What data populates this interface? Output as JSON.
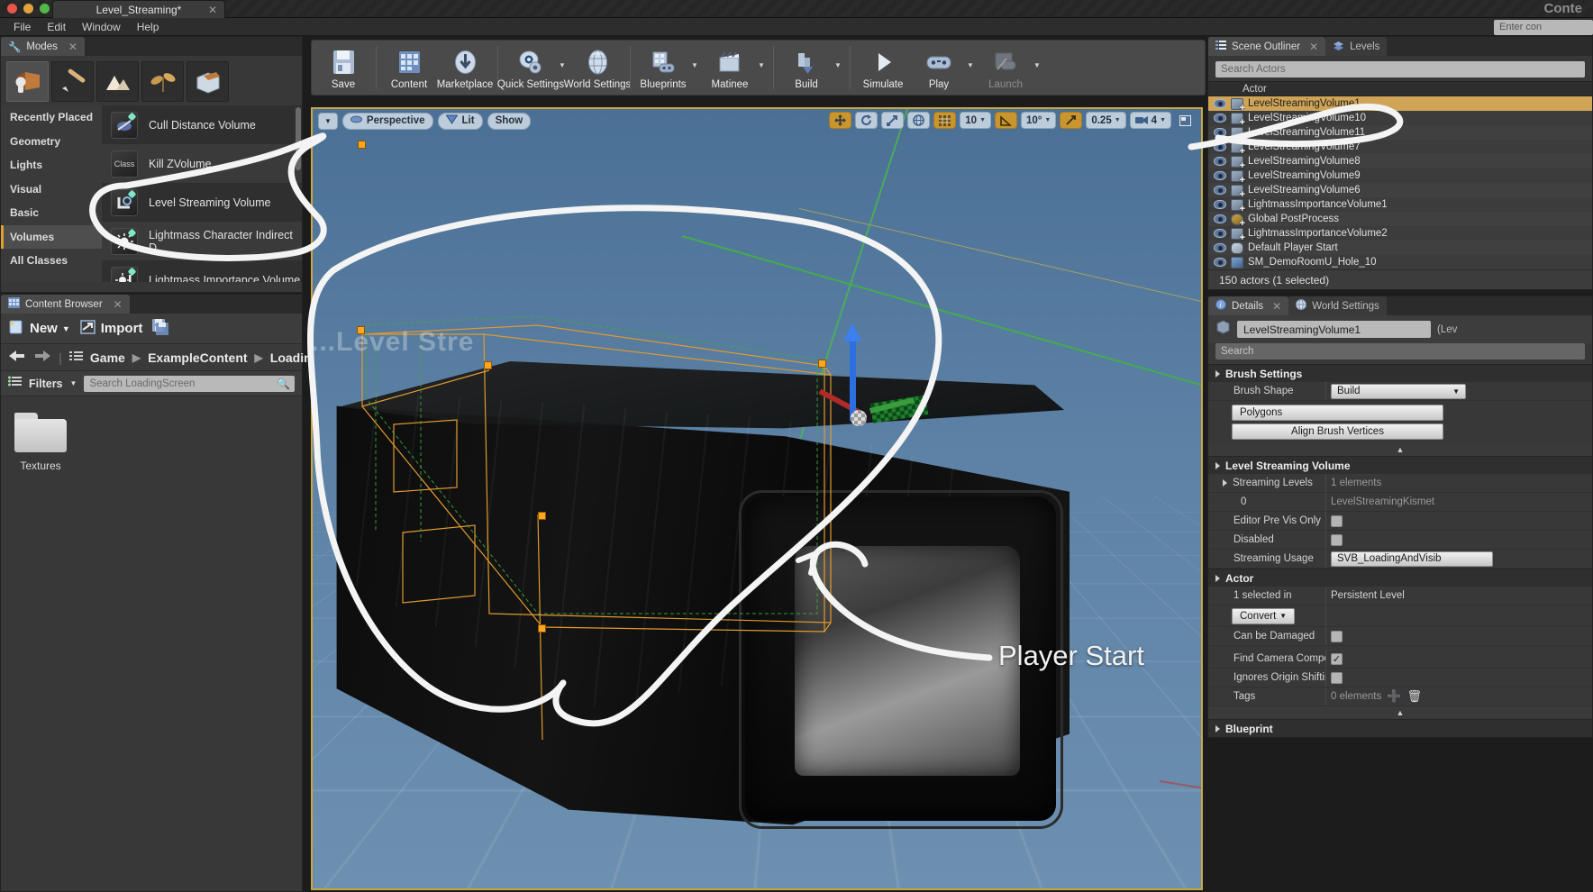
{
  "titlebar": {
    "document_tab": "Level_Streaming*",
    "window_label": "Conte"
  },
  "menubar": {
    "items": [
      "File",
      "Edit",
      "Window",
      "Help"
    ],
    "command_placeholder": "Enter con"
  },
  "modes": {
    "tab_label": "Modes",
    "mode_buttons": [
      "place-mode",
      "paint-mode",
      "landscape-mode",
      "foliage-mode",
      "geometry-edit-mode"
    ],
    "categories": [
      "Recently Placed",
      "Geometry",
      "Lights",
      "Visual",
      "Basic",
      "Volumes",
      "All Classes"
    ],
    "selected_category": "Volumes",
    "volume_items": [
      {
        "label": "Cull Distance Volume",
        "icon": "cull-distance-volume-icon"
      },
      {
        "label": "Kill ZVolume",
        "icon": "class-icon"
      },
      {
        "label": "Level Streaming Volume",
        "icon": "level-streaming-volume-icon"
      },
      {
        "label": "Lightmass Character Indirect D",
        "icon": "lightmass-character-indirect-icon"
      },
      {
        "label": "Lightmass Importance Volume",
        "icon": "lightmass-importance-volume-icon"
      }
    ]
  },
  "toolbar": {
    "buttons": [
      {
        "label": "Save",
        "icon": "save-icon",
        "caret": false,
        "dim": false
      },
      {
        "label": "Content",
        "icon": "content-icon",
        "caret": false,
        "dim": false
      },
      {
        "label": "Marketplace",
        "icon": "marketplace-icon",
        "caret": false,
        "dim": false
      },
      {
        "label": "Quick Settings",
        "icon": "quick-settings-icon",
        "caret": true,
        "dim": false
      },
      {
        "label": "World Settings",
        "icon": "world-settings-icon",
        "caret": false,
        "dim": false
      },
      {
        "label": "Blueprints",
        "icon": "blueprints-icon",
        "caret": true,
        "dim": false
      },
      {
        "label": "Matinee",
        "icon": "matinee-icon",
        "caret": true,
        "dim": false
      },
      {
        "label": "Build",
        "icon": "build-icon",
        "caret": true,
        "dim": false
      },
      {
        "label": "Simulate",
        "icon": "simulate-icon",
        "caret": false,
        "dim": false
      },
      {
        "label": "Play",
        "icon": "play-icon",
        "caret": true,
        "dim": false
      },
      {
        "label": "Launch",
        "icon": "launch-icon",
        "caret": true,
        "dim": true
      }
    ]
  },
  "content_browser": {
    "tab_label": "Content Browser",
    "new_label": "New",
    "import_label": "Import",
    "save_all_icon": "save-all-icon",
    "breadcrumbs": [
      "Game",
      "ExampleContent",
      "Loadin"
    ],
    "filters_label": "Filters",
    "search_placeholder": "Search LoadingScreen",
    "assets": [
      {
        "label": "Textures",
        "icon": "folder-icon"
      }
    ]
  },
  "viewport": {
    "view_mode_label": "Perspective",
    "lighting_label": "Lit",
    "show_label": "Show",
    "grid_snap_value": "10",
    "rotation_snap_value": "10°",
    "scale_snap_value": "0.25",
    "camera_speed_value": "4",
    "watermark_text": "...Level Stre",
    "annotations": [
      {
        "text": "Player Start",
        "kind": "handwriting-label"
      }
    ]
  },
  "scene_outliner": {
    "tabs": [
      {
        "label": "Scene Outliner",
        "icon": "scene-outliner-icon",
        "active": true
      },
      {
        "label": "Levels",
        "icon": "levels-icon",
        "active": false
      }
    ],
    "search_placeholder": "Search Actors",
    "column_header": "Actor",
    "rows": [
      {
        "label": "LevelStreamingVolume1",
        "icon": "volume-actor-icon",
        "selected": true
      },
      {
        "label": "LevelStreamingVolume10",
        "icon": "volume-actor-icon",
        "selected": false
      },
      {
        "label": "LevelStreamingVolume11",
        "icon": "volume-actor-icon",
        "selected": false
      },
      {
        "label": "LevelStreamingVolume7",
        "icon": "volume-actor-icon",
        "selected": false
      },
      {
        "label": "LevelStreamingVolume8",
        "icon": "volume-actor-icon",
        "selected": false
      },
      {
        "label": "LevelStreamingVolume9",
        "icon": "volume-actor-icon",
        "selected": false
      },
      {
        "label": "LevelStreamingVolume6",
        "icon": "volume-actor-icon",
        "selected": false
      },
      {
        "label": "LightmassImportanceVolume1",
        "icon": "volume-actor-icon",
        "selected": false
      },
      {
        "label": "Global PostProcess",
        "icon": "postprocess-actor-icon",
        "selected": false
      },
      {
        "label": "LightmassImportanceVolume2",
        "icon": "volume-actor-icon",
        "selected": false
      },
      {
        "label": "Default Player Start",
        "icon": "player-start-icon",
        "selected": false
      },
      {
        "label": "SM_DemoRoomU_Hole_10",
        "icon": "static-mesh-icon",
        "selected": false
      }
    ],
    "status": "150 actors (1 selected)"
  },
  "details": {
    "tabs": [
      {
        "label": "Details",
        "icon": "details-icon",
        "active": true
      },
      {
        "label": "World Settings",
        "icon": "world-settings-icon",
        "active": false
      }
    ],
    "actor_name": "LevelStreamingVolume1",
    "actor_name_suffix": "(Lev",
    "search_placeholder": "Search",
    "brush_settings": {
      "title": "Brush Settings",
      "brush_shape_label": "Brush Shape",
      "brush_shape_value": "Build",
      "polygons_label": "Polygons",
      "align_label": "Align Brush Vertices"
    },
    "level_streaming_volume": {
      "title": "Level Streaming Volume",
      "streaming_levels_label": "Streaming Levels",
      "streaming_levels_count": "1 elements",
      "element_index": "0",
      "element_value": "LevelStreamingKismet",
      "editor_pre_vis_only_label": "Editor Pre Vis Only",
      "editor_pre_vis_only_checked": false,
      "disabled_label": "Disabled",
      "disabled_checked": false,
      "streaming_usage_label": "Streaming Usage",
      "streaming_usage_value": "SVB_LoadingAndVisib"
    },
    "actor_section": {
      "title": "Actor",
      "selected_in_label": "1 selected in",
      "selected_in_value": "Persistent Level",
      "convert_label": "Convert",
      "can_be_damaged_label": "Can be Damaged",
      "can_be_damaged_checked": false,
      "find_camera_label": "Find Camera Compo",
      "find_camera_checked": true,
      "ignores_origin_label": "Ignores Origin Shiftin",
      "ignores_origin_checked": false,
      "tags_label": "Tags",
      "tags_value": "0 elements",
      "add_icon": "plus-icon",
      "delete_icon": "trash-icon"
    },
    "blueprint_section": {
      "title": "Blueprint"
    }
  }
}
